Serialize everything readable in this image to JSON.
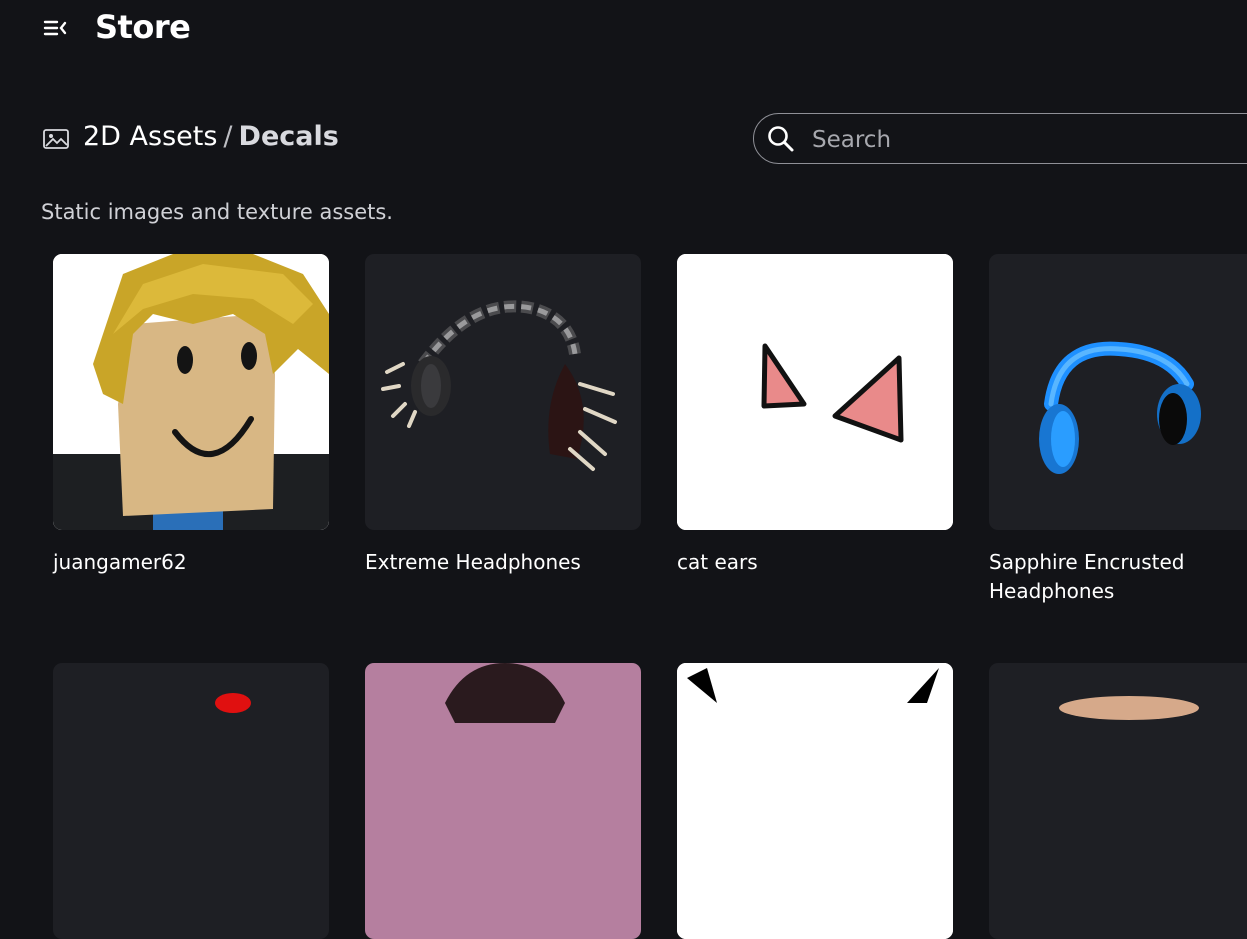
{
  "header": {
    "title": "Store",
    "menu_icon": "menu-collapse-icon"
  },
  "breadcrumb": {
    "icon": "image-icon",
    "parent": "2D Assets",
    "separator": "/",
    "current": "Decals"
  },
  "search": {
    "placeholder": "Search",
    "value": "",
    "icon": "search-icon"
  },
  "subtitle": "Static images and texture assets.",
  "items": [
    {
      "name": "juangamer62"
    },
    {
      "name": "Extreme Headphones"
    },
    {
      "name": "cat ears"
    },
    {
      "name": "Sapphire Encrusted Headphones"
    }
  ],
  "colors": {
    "background": "#121317",
    "card": "#1e1f24",
    "text": "#ffffff",
    "muted": "#d0d1d6",
    "border": "#8f9097"
  }
}
